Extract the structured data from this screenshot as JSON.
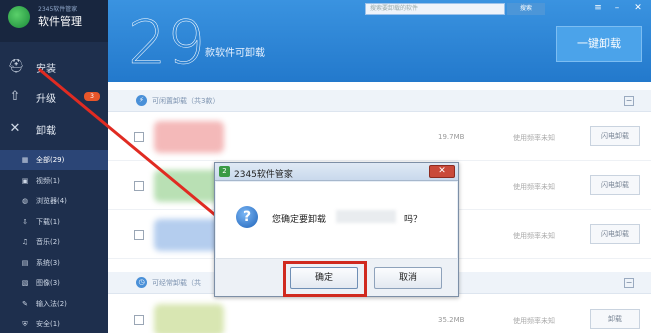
{
  "brand": {
    "small": "2345软件管家",
    "title": "软件管理"
  },
  "nav": {
    "install": "安装",
    "upgrade": "升级",
    "upgrade_badge": "3",
    "uninstall": "卸载"
  },
  "categories": [
    {
      "label": "全部(29)",
      "icon": "grid-icon",
      "active": true
    },
    {
      "label": "视频(1)",
      "icon": "video-icon",
      "active": false
    },
    {
      "label": "浏览器(4)",
      "icon": "browser-icon",
      "active": false
    },
    {
      "label": "下载(1)",
      "icon": "download-icon",
      "active": false
    },
    {
      "label": "音乐(2)",
      "icon": "music-icon",
      "active": false
    },
    {
      "label": "系统(3)",
      "icon": "system-icon",
      "active": false
    },
    {
      "label": "图像(3)",
      "icon": "image-icon",
      "active": false
    },
    {
      "label": "输入法(2)",
      "icon": "keyboard-icon",
      "active": false
    },
    {
      "label": "安全(1)",
      "icon": "shield-icon",
      "active": false
    }
  ],
  "header": {
    "count": "29",
    "count_label": "款软件可卸载",
    "search_placeholder": "搜索要卸载的软件",
    "search_button": "搜索",
    "one_key_uninstall": "一键卸载"
  },
  "sections": [
    {
      "label": "可闲置卸载（共3款）"
    },
    {
      "label": "可经常卸载（共"
    }
  ],
  "rows": [
    {
      "size": "19.7MB",
      "freq": "使用频率未知",
      "button": "闪电卸载",
      "color": "#f4b9b9"
    },
    {
      "size": "",
      "freq": "使用频率未知",
      "button": "闪电卸载",
      "color": "#b9e0b4"
    },
    {
      "size": "",
      "freq": "使用频率未知",
      "button": "闪电卸载",
      "color": "#b4cdee"
    },
    {
      "size": "35.2MB",
      "freq": "使用频率未知",
      "button": "卸载",
      "color": "#d8e6b2"
    }
  ],
  "dialog": {
    "title": "2345软件管家",
    "message": "您确定要卸载",
    "suffix": "吗？",
    "ok": "确定",
    "cancel": "取消"
  },
  "colors": {
    "sidebar": "#1e2f4d",
    "header": "#2b86d8",
    "highlight": "#d02a1f"
  }
}
